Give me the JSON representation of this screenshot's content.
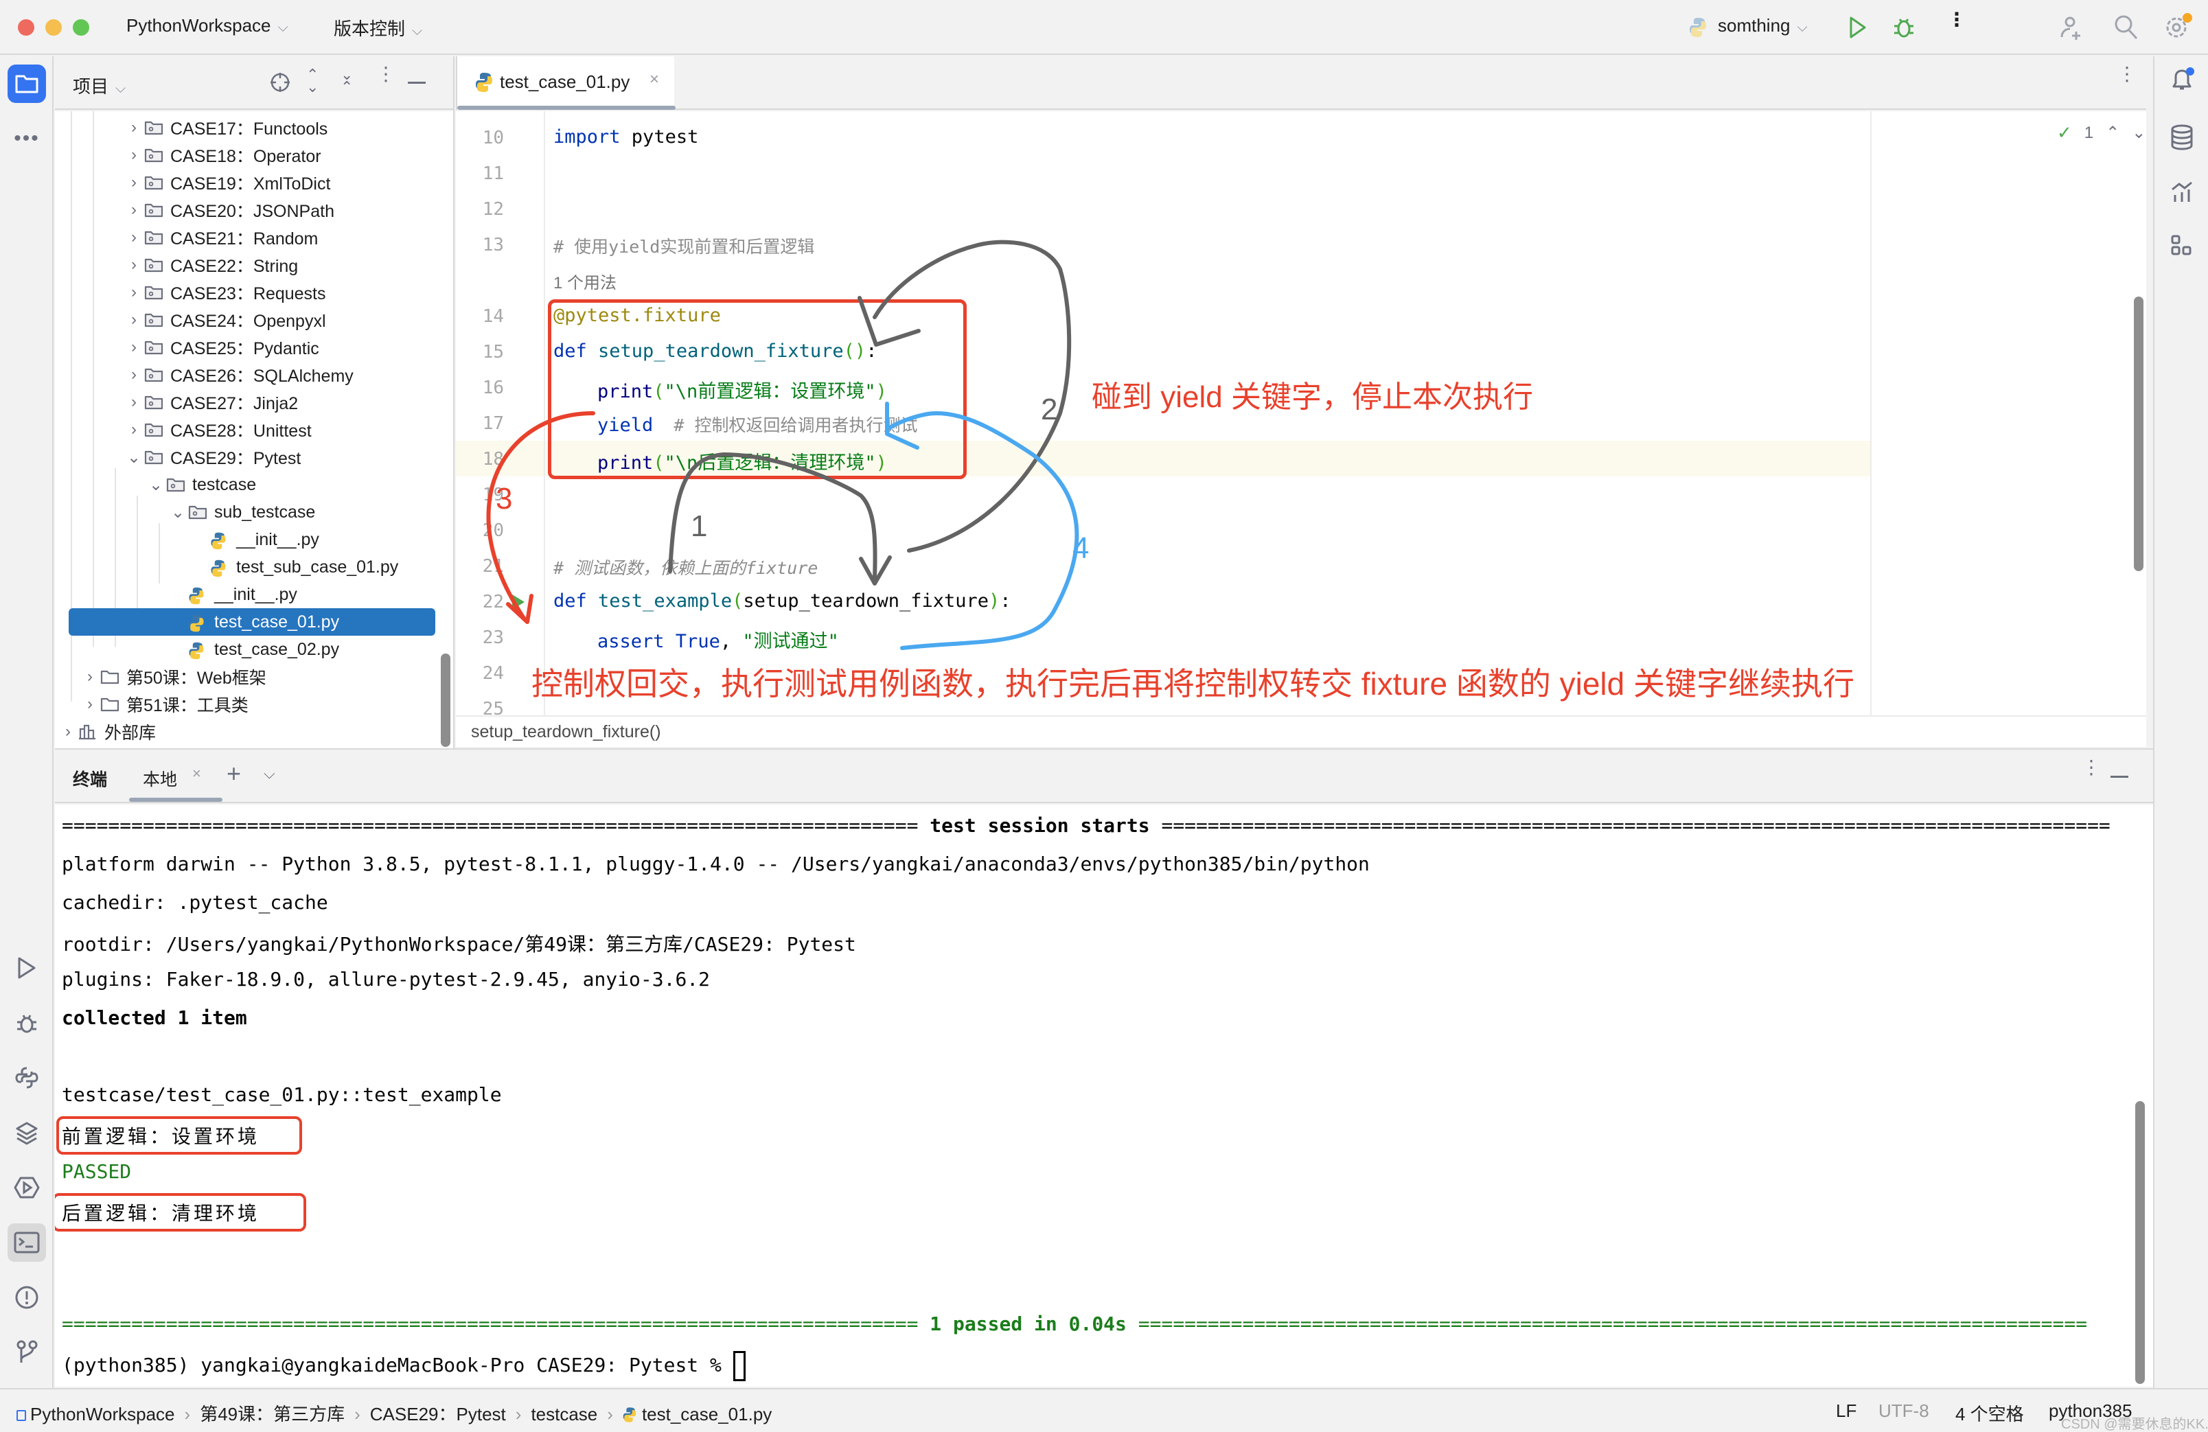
{
  "titlebar": {
    "project_name": "PythonWorkspace",
    "vcs_label": "版本控制",
    "run_config": "somthing",
    "colors": {
      "close": "#ee6a5f",
      "minimize": "#f5be4f",
      "maximize": "#62c654",
      "run": "#4fa84f"
    }
  },
  "project_panel": {
    "title": "项目",
    "tree": [
      {
        "label": "CASE17：Functools",
        "type": "folder",
        "expanded": false
      },
      {
        "label": "CASE18：Operator",
        "type": "folder",
        "expanded": false
      },
      {
        "label": "CASE19：XmlToDict",
        "type": "folder",
        "expanded": false
      },
      {
        "label": "CASE20：JSONPath",
        "type": "folder",
        "expanded": false
      },
      {
        "label": "CASE21：Random",
        "type": "folder",
        "expanded": false
      },
      {
        "label": "CASE22：String",
        "type": "folder",
        "expanded": false
      },
      {
        "label": "CASE23：Requests",
        "type": "folder",
        "expanded": false
      },
      {
        "label": "CASE24：Openpyxl",
        "type": "folder",
        "expanded": false
      },
      {
        "label": "CASE25：Pydantic",
        "type": "folder",
        "expanded": false
      },
      {
        "label": "CASE26：SQLAlchemy",
        "type": "folder",
        "expanded": false
      },
      {
        "label": "CASE27：Jinja2",
        "type": "folder",
        "expanded": false
      },
      {
        "label": "CASE28：Unittest",
        "type": "folder",
        "expanded": false
      },
      {
        "label": "CASE29：Pytest",
        "type": "folder",
        "expanded": true
      },
      {
        "label": "testcase",
        "type": "folder",
        "expanded": true
      },
      {
        "label": "sub_testcase",
        "type": "folder",
        "expanded": true
      },
      {
        "label": "__init__.py",
        "type": "python"
      },
      {
        "label": "test_sub_case_01.py",
        "type": "python"
      },
      {
        "label": "__init__.py",
        "type": "python"
      },
      {
        "label": "test_case_01.py",
        "type": "python",
        "selected": true
      },
      {
        "label": "test_case_02.py",
        "type": "python"
      },
      {
        "label": "第50课：Web框架",
        "type": "plain-folder",
        "expanded": false
      },
      {
        "label": "第51课：工具类",
        "type": "plain-folder",
        "expanded": false
      },
      {
        "label": "外部库",
        "type": "library",
        "expanded": false
      }
    ]
  },
  "editor": {
    "tab_label": "test_case_01.py",
    "inspection_count": "1",
    "usage_hint": "1 个用法",
    "line_numbers": [
      "10",
      "11",
      "12",
      "13",
      "14",
      "15",
      "16",
      "17",
      "18",
      "19",
      "20",
      "21",
      "22",
      "23",
      "24",
      "25"
    ],
    "lines": {
      "l10": {
        "kw": "import",
        "rest": " pytest"
      },
      "l13": "# 使用yield实现前置和后置逻辑",
      "l14": "@pytest.fixture",
      "l15": {
        "kw": "def",
        "fn": " setup_teardown_fixture",
        "open": "(",
        "close": ")",
        "tail": ":"
      },
      "l16": {
        "fn": "print",
        "open": "(",
        "str": "\"\\n前置逻辑：设置环境\"",
        "close": ")"
      },
      "l17": {
        "kw": "yield",
        "comment": "  # 控制权返回给调用者执行测试"
      },
      "l18": {
        "fn": "print",
        "open": "(",
        "str": "\"\\n后置逻辑：清理环境\"",
        "close": ")"
      },
      "l21": "# 测试函数，依赖上面的fixture",
      "l22": {
        "kw": "def",
        "fn": " test_example",
        "open": "(",
        "arg": "setup_teardown_fixture",
        "close": ")",
        "tail": ":"
      },
      "l23": {
        "kw": "assert",
        "kw2": " True",
        "sep": ", ",
        "str": "\"测试通过\""
      }
    },
    "breadcrumb": "setup_teardown_fixture()"
  },
  "annotations": {
    "yield_note": "碰到 yield 关键字，停止本次执行",
    "control_note": "控制权回交，执行测试用例函数，执行完后再将控制权转交 fixture 函数的 yield 关键字继续执行",
    "step_labels": [
      "1",
      "2",
      "3",
      "4"
    ]
  },
  "terminal": {
    "tab_title": "终端",
    "session_tab": "本地",
    "lines": {
      "header_left": "==========================================================================",
      "header_title": " test session starts ",
      "header_right": "==================================================================================",
      "platform": "platform darwin -- Python 3.8.5, pytest-8.1.1, pluggy-1.4.0 -- /Users/yangkai/anaconda3/envs/python385/bin/python",
      "cachedir": "cachedir: .pytest_cache",
      "rootdir": "rootdir: /Users/yangkai/PythonWorkspace/第49课：第三方库/CASE29: Pytest",
      "plugins": "plugins: Faker-18.9.0, allure-pytest-2.9.45, anyio-3.6.2",
      "collected": "collected 1 item",
      "test_id": "testcase/test_case_01.py::test_example",
      "setup_output": "前置逻辑：设置环境",
      "passed": "PASSED",
      "teardown_output": "后置逻辑：清理环境",
      "summary_left": "==========================================================================",
      "summary": " 1 passed in 0.04s ",
      "summary_right": "==================================================================================",
      "prompt": "(python385) yangkai@yangkaideMacBook-Pro CASE29: Pytest % "
    }
  },
  "statusbar": {
    "breadcrumb": [
      "PythonWorkspace",
      "第49课：第三方库",
      "CASE29：Pytest",
      "testcase",
      "test_case_01.py"
    ],
    "line_ending": "LF",
    "encoding": "UTF-8",
    "indent": "4 个空格",
    "interpreter": "python385",
    "watermark": "CSDN @需要休息的KK."
  }
}
